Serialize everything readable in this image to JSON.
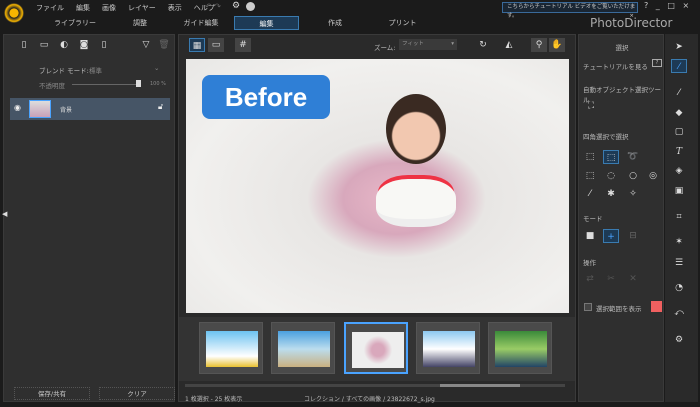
{
  "menu": [
    "ファイル",
    "編集",
    "画像",
    "レイヤー",
    "表示",
    "ヘルプ"
  ],
  "tabs": [
    {
      "label": "ライブラリー"
    },
    {
      "label": "調整"
    },
    {
      "label": "ガイド編集"
    },
    {
      "label": "編集",
      "active": true
    },
    {
      "label": "作成"
    },
    {
      "label": "プリント"
    }
  ],
  "tooltip": "こちらからチュートリアル ビデオをご覧いただけます。",
  "brand": "PhotoDirector",
  "window_controls": [
    "?",
    "_",
    "□",
    "×"
  ],
  "left": {
    "blend_label": "ブレンド モード:",
    "blend_value": "標準",
    "opacity_label": "不透明度",
    "opacity_value": "100 %",
    "opacity_percent": 100,
    "layer_name": "背景",
    "save_share": "保存/共有",
    "clear": "クリア"
  },
  "toolbar": {
    "zoom_label": "ズーム:",
    "zoom_value": "フィット"
  },
  "canvas": {
    "badge": "Before"
  },
  "right": {
    "title": "選択",
    "tutorial": "チュートリアルを見る",
    "auto_tool": "自動オブジェクト選択ツール",
    "rect_select": "四角選択で選択",
    "mode": "モード",
    "operation": "操作",
    "show_selection": "選択範囲を表示",
    "selection_color": "#f06060"
  },
  "status": {
    "count": "1 枚選択 - 25 枚表示",
    "path": "コレクション / すべての画像 / 23822672_s.jpg"
  },
  "colors": {
    "accent": "#2f7fd6",
    "active_tab": "#1d3a55"
  }
}
